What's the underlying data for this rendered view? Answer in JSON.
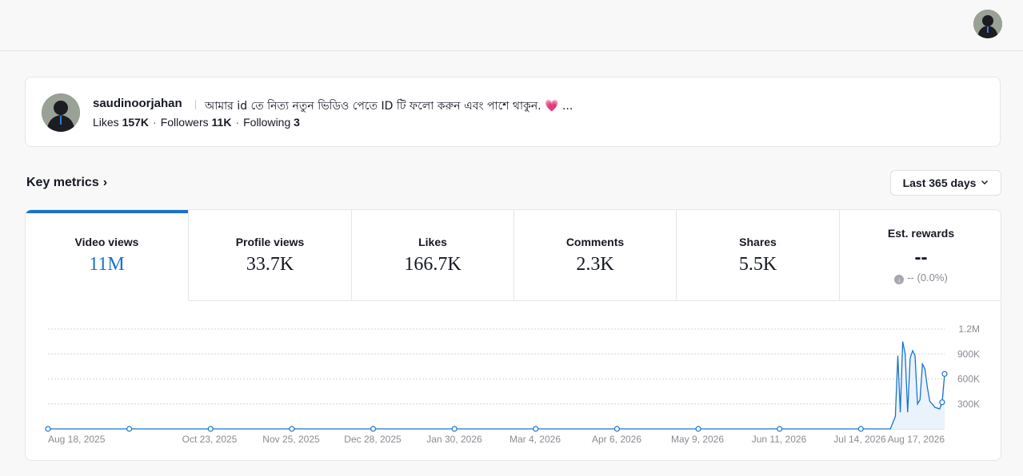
{
  "header": {
    "avatar_icon": "user-avatar-icon"
  },
  "profile": {
    "username": "saudinoorjahan",
    "bio": "আমার id তে নিত্য নতুন ভিডিও পেতে ID টি ফলো করুন এবং পাশে থাকুন. 💗 ...",
    "likes_label": "Likes",
    "likes_value": "157K",
    "followers_label": "Followers",
    "followers_value": "11K",
    "following_label": "Following",
    "following_value": "3"
  },
  "key_metrics": {
    "title": "Key metrics",
    "title_chevron": "›",
    "range_label": "Last 365 days",
    "range_chevron": "⌄"
  },
  "tabs": [
    {
      "label": "Video views",
      "value": "11M"
    },
    {
      "label": "Profile views",
      "value": "33.7K"
    },
    {
      "label": "Likes",
      "value": "166.7K"
    },
    {
      "label": "Comments",
      "value": "2.3K"
    },
    {
      "label": "Shares",
      "value": "5.5K"
    },
    {
      "label": "Est. rewards",
      "value": "--",
      "change": "-- (0.0%)"
    }
  ],
  "colors": {
    "accent": "#1a73c9",
    "grid": "#d6d6d9",
    "fill": "#eaf3fb"
  },
  "chart_data": {
    "type": "line",
    "y_tick_labels": [
      "1.2M",
      "900K",
      "600K",
      "300K"
    ],
    "y_ticks": [
      1200000,
      900000,
      600000,
      300000
    ],
    "ylim": [
      0,
      1200000
    ],
    "x_tick_labels": [
      "Aug 18, 2025",
      "Oct 23, 2025",
      "Nov 25, 2025",
      "Dec 28, 2025",
      "Jan 30, 2026",
      "Mar 4, 2026",
      "Apr 6, 2026",
      "May 9, 2026",
      "Jun 11, 2026",
      "Jul 14, 2026",
      "Aug 17, 2026"
    ],
    "x_range_days": [
      0,
      364
    ],
    "series": [
      {
        "points": [
          [
            0,
            0
          ],
          [
            33,
            0
          ],
          [
            66,
            0
          ],
          [
            99,
            0
          ],
          [
            132,
            0
          ],
          [
            165,
            0
          ],
          [
            198,
            0
          ],
          [
            231,
            0
          ],
          [
            264,
            0
          ],
          [
            297,
            0
          ],
          [
            330,
            0
          ],
          [
            342,
            0
          ],
          [
            344,
            150000
          ],
          [
            345,
            880000
          ],
          [
            346,
            200000
          ],
          [
            347,
            1050000
          ],
          [
            348,
            900000
          ],
          [
            349,
            200000
          ],
          [
            350,
            850000
          ],
          [
            351,
            940000
          ],
          [
            352,
            880000
          ],
          [
            353,
            300000
          ],
          [
            354,
            350000
          ],
          [
            355,
            780000
          ],
          [
            356,
            720000
          ],
          [
            357,
            500000
          ],
          [
            358,
            330000
          ],
          [
            359,
            300000
          ],
          [
            360,
            260000
          ],
          [
            361,
            250000
          ],
          [
            362,
            240000
          ],
          [
            363,
            320000
          ],
          [
            364,
            660000
          ]
        ],
        "markers": [
          0,
          33,
          66,
          99,
          132,
          165,
          198,
          231,
          264,
          297,
          330,
          363,
          364
        ]
      }
    ]
  }
}
